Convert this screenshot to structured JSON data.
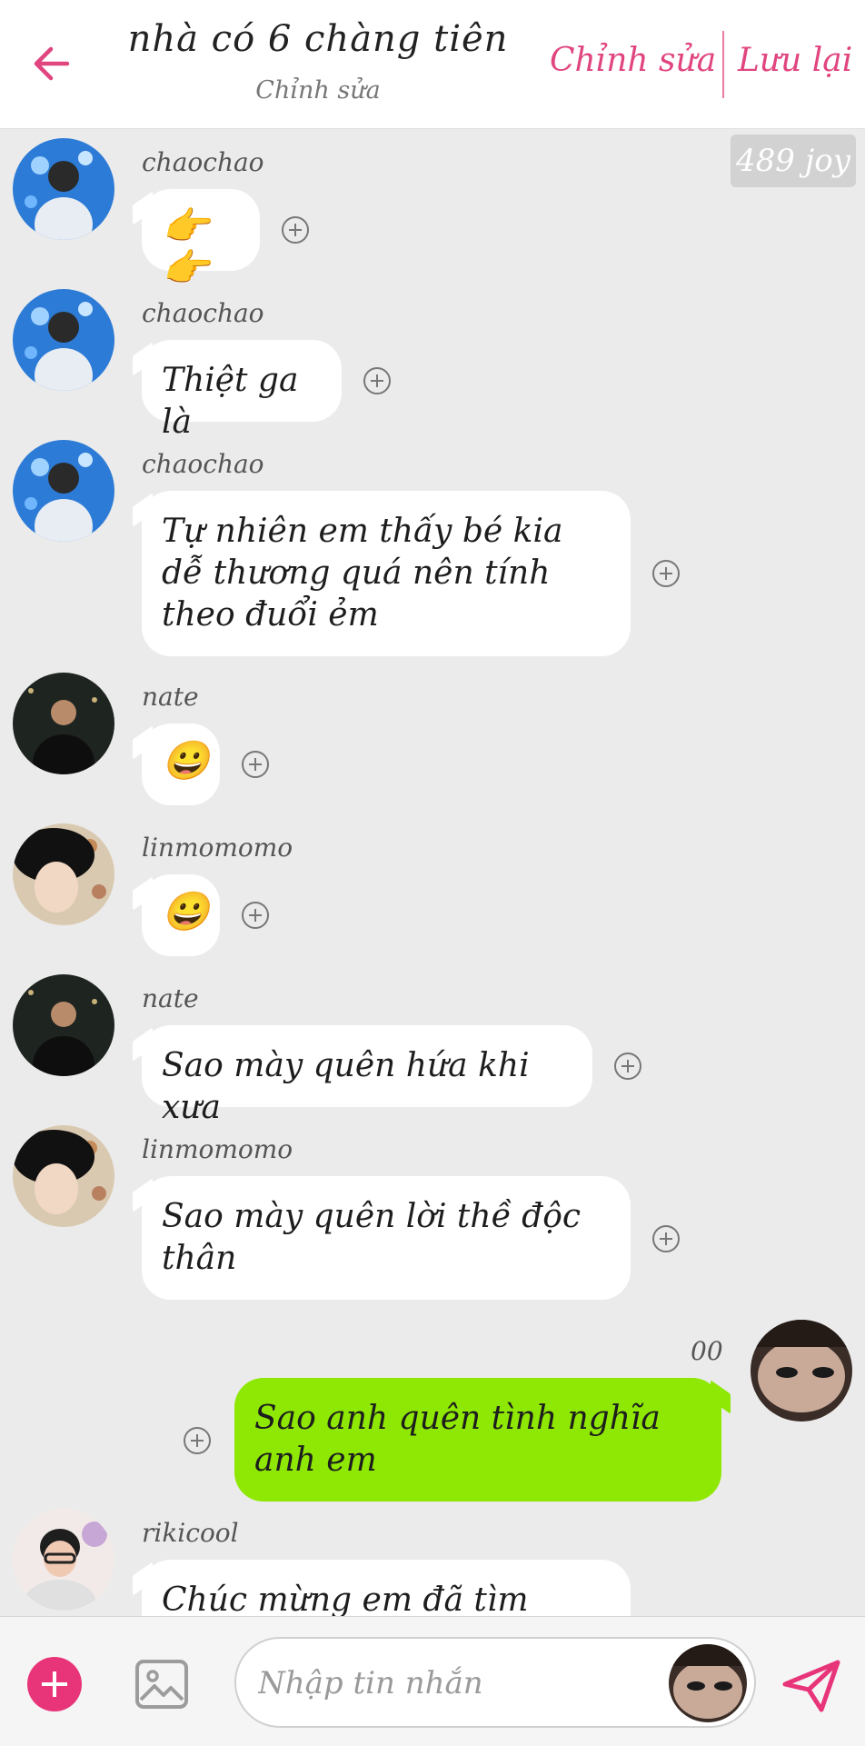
{
  "header": {
    "title": "nhà có 6 chàng tiên",
    "subtitle": "Chỉnh sửa",
    "edit_label": "Chỉnh sửa",
    "save_label": "Lưu lại",
    "accent_color": "#e0457f"
  },
  "joy_badge": "489 joy",
  "messages": [
    {
      "sender": "chaochao",
      "text": "👉👉",
      "type": "emoji"
    },
    {
      "sender": "chaochao",
      "text": "Thiệt ga là"
    },
    {
      "sender": "chaochao",
      "text": "Tự nhiên em thấy bé kia dễ thương quá nên tính theo đuổi ẻm"
    },
    {
      "sender": "nate",
      "text": "😀",
      "type": "emoji"
    },
    {
      "sender": "linmomomo",
      "text": "😀",
      "type": "emoji"
    },
    {
      "sender": "nate",
      "text": "Sao mày quên hứa khi xưa"
    },
    {
      "sender": "linmomomo",
      "text": "Sao mày quên lời thề độc thân"
    },
    {
      "sender": "00",
      "text": "Sao anh quên tình nghĩa anh em",
      "self": true
    },
    {
      "sender": "rikicool",
      "text": "Chúc mừng em đã tìm được"
    }
  ],
  "composer": {
    "placeholder": "Nhập tin nhắn",
    "send_color": "#e8357a",
    "self_bubble_color": "#8ee804"
  }
}
